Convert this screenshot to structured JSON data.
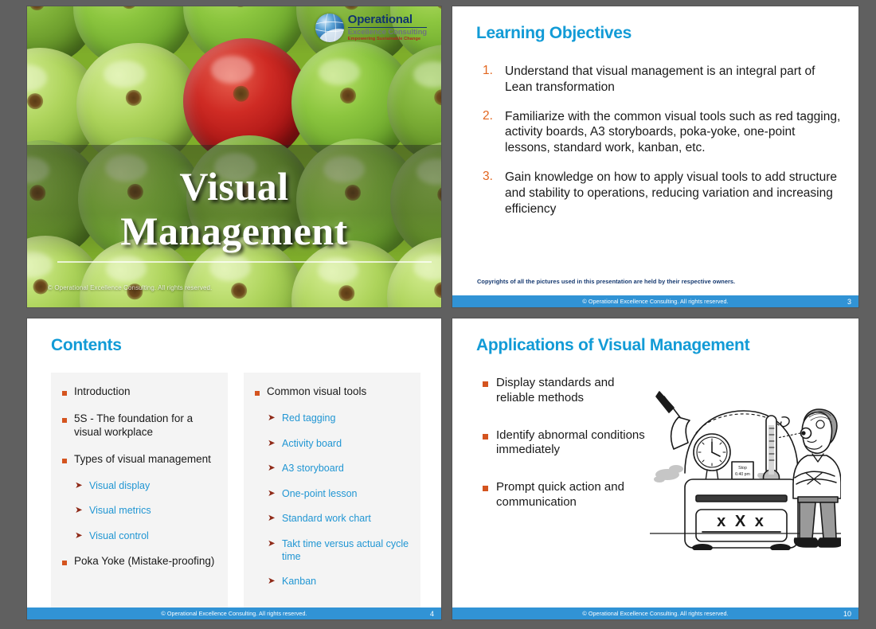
{
  "deck": {
    "brand": {
      "line1": "Operational",
      "line2": "Excellence Consulting",
      "line3": "Empowering Sustainable Change"
    },
    "footer_text": "© Operational Excellence Consulting.  All rights reserved.",
    "colors": {
      "accent_blue": "#129bd6",
      "footer_blue": "#3193d5",
      "bullet_orange": "#d4541f",
      "number_orange": "#e2661f",
      "sub_text_blue": "#2196d3",
      "arrow_maroon": "#8f2a18",
      "background_gray": "#606060"
    }
  },
  "slide_title": {
    "title_line1": "Visual",
    "title_line2": "Management",
    "copyright": "© Operational Excellence Consulting.  All rights reserved."
  },
  "slide_objectives": {
    "heading": "Learning Objectives",
    "items": [
      {
        "num": "1.",
        "text": "Understand that visual management is an integral part of Lean transformation"
      },
      {
        "num": "2.",
        "text": "Familiarize with the common visual tools such as red tagging, activity boards, A3 storyboards, poka-yoke, one-point lessons, standard work, kanban, etc."
      },
      {
        "num": "3.",
        "text": "Gain knowledge on how to apply visual tools to add structure and stability to operations, reducing variation and increasing efficiency"
      }
    ],
    "note": "Copyrights of all the pictures used in this presentation are held by their respective owners.",
    "page": "3"
  },
  "slide_contents": {
    "heading": "Contents",
    "left_column": [
      {
        "level": 1,
        "text": "Introduction"
      },
      {
        "level": 1,
        "text": "5S - The foundation for a visual workplace"
      },
      {
        "level": 1,
        "text": "Types of visual management"
      },
      {
        "level": 2,
        "text": "Visual display"
      },
      {
        "level": 2,
        "text": "Visual metrics"
      },
      {
        "level": 2,
        "text": "Visual control"
      },
      {
        "level": 1,
        "text": "Poka Yoke (Mistake-proofing)"
      }
    ],
    "right_column": [
      {
        "level": 1,
        "text": "Common visual tools"
      },
      {
        "level": 2,
        "text": "Red tagging"
      },
      {
        "level": 2,
        "text": "Activity board"
      },
      {
        "level": 2,
        "text": "A3 storyboard"
      },
      {
        "level": 2,
        "text": "One-point lesson"
      },
      {
        "level": 2,
        "text": "Standard work chart"
      },
      {
        "level": 2,
        "text": "Takt time versus actual cycle time"
      },
      {
        "level": 2,
        "text": "Kanban"
      }
    ],
    "page": "4"
  },
  "slide_applications": {
    "heading": "Applications of Visual Management",
    "items": [
      "Display standards and reliable methods",
      "Identify abnormal conditions immediately",
      "Prompt quick action and communication"
    ],
    "illustration": {
      "display_text": "x X x",
      "sign_line1": "Stop",
      "sign_line2": "6:40 pm"
    },
    "page": "10"
  }
}
